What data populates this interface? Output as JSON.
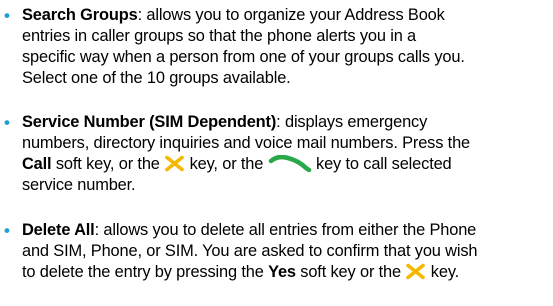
{
  "items": [
    {
      "title": "Search Groups",
      "line1_rest": ": allows you to organize your Address Book",
      "line2": "entries in caller groups so that the phone alerts you in a",
      "line3": "specific way when a person from one of your groups calls you.",
      "line4": "Select one of the 10 groups available."
    },
    {
      "title": "Service Number (SIM Dependent)",
      "line1_rest": ": displays emergency",
      "line2": "numbers, directory inquiries and voice mail numbers. Press the",
      "line3_bold": "Call",
      "line3_a": " soft key, or the ",
      "line3_b": " key, or the ",
      "line3_c": " key to call selected",
      "line4": "service number."
    },
    {
      "title": "Delete All",
      "line1_rest": ": allows you to delete all entries from either the Phone",
      "line2": "and SIM, Phone, or SIM. You are asked to confirm that you wish",
      "line3_a": "to delete the entry by pressing the ",
      "line3_bold": "Yes",
      "line3_b": " soft key or the ",
      "line3_c": " key."
    }
  ],
  "icons": {
    "select_key": "select-key-icon",
    "send_key": "send-key-icon"
  },
  "colors": {
    "bullet": "#1a9fd8",
    "select_key": "#f5b800",
    "send_key": "#2aa84a"
  }
}
